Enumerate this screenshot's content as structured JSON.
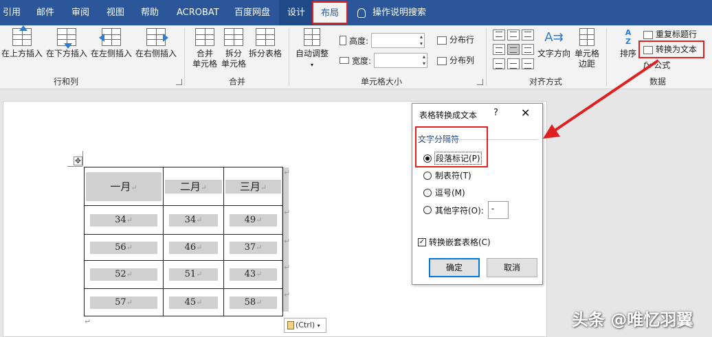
{
  "tabs": {
    "items": [
      "引用",
      "邮件",
      "审阅",
      "视图",
      "帮助",
      "ACROBAT",
      "百度网盘"
    ],
    "design": "设计",
    "layout": "布局",
    "tell_me": "操作说明搜索"
  },
  "ribbon": {
    "rows_cols": {
      "insert_above": "在上方插入",
      "insert_below": "在下方插入",
      "insert_left": "在左侧插入",
      "insert_right": "在右侧插入",
      "group_label": "行和列"
    },
    "merge": {
      "merge_cells": [
        "合并",
        "单元格"
      ],
      "split_cells": [
        "拆分",
        "单元格"
      ],
      "split_table": "拆分表格",
      "group_label": "合并"
    },
    "cell_size": {
      "autofit": "自动调整",
      "height_label": "高度:",
      "width_label": "宽度:",
      "distribute_rows": "分布行",
      "distribute_cols": "分布列",
      "group_label": "单元格大小"
    },
    "alignment": {
      "text_direction": "文字方向",
      "cell_margins": [
        "单元格",
        "边距"
      ],
      "group_label": "对齐方式"
    },
    "data": {
      "sort": "排序",
      "repeat_header": "重复标题行",
      "convert_to_text": "转换为文本",
      "formula": "公式",
      "group_label": "数据"
    }
  },
  "table": {
    "headers": [
      "一月",
      "二月",
      "三月"
    ],
    "rows": [
      [
        "34",
        "34",
        "49"
      ],
      [
        "56",
        "46",
        "37"
      ],
      [
        "52",
        "51",
        "43"
      ],
      [
        "57",
        "45",
        "58"
      ]
    ]
  },
  "paste_options": "(Ctrl)",
  "dialog": {
    "title": "表格转换成文本",
    "help": "?",
    "close": "✕",
    "separator_group": "文字分隔符",
    "options": [
      "段落标记(P)",
      "制表符(T)",
      "逗号(M)",
      "其他字符(O):"
    ],
    "other_char_value": "-",
    "convert_nested": "转换嵌套表格(C)",
    "ok": "确定",
    "cancel": "取消"
  },
  "colors": {
    "ribbon_blue": "#2b579a",
    "highlight_red": "#e02020",
    "default_button_blue": "#0078d7"
  },
  "watermark": "头条 @唯忆羽翼"
}
